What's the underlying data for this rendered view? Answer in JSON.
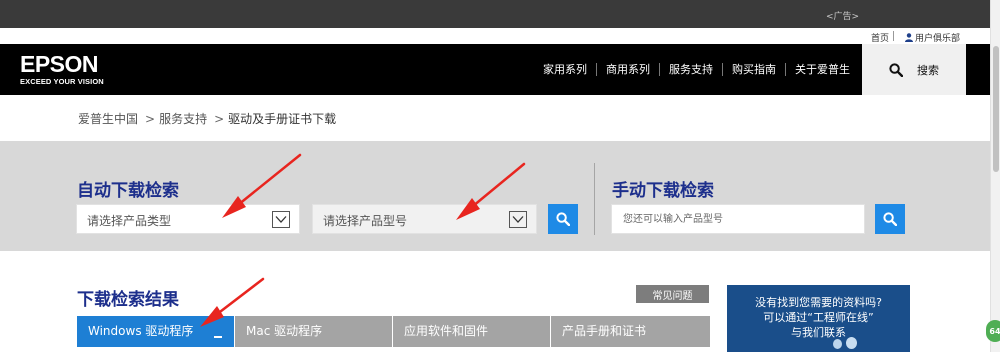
{
  "ad": {
    "label": "<广告>"
  },
  "utility": {
    "home": "首页",
    "club": "用户俱乐部"
  },
  "header": {
    "logo": "EPSON",
    "tagline": "EXCEED YOUR VISION",
    "nav": [
      "家用系列",
      "商用系列",
      "服务支持",
      "购买指南",
      "关于爱普生"
    ],
    "search_label": "搜索"
  },
  "breadcrumb": [
    "爱普生中国",
    "服务支持",
    "驱动及手册证书下载"
  ],
  "breadcrumb_sep": ">",
  "auto_search": {
    "title": "自动下载检索",
    "type_select": "请选择产品类型",
    "model_select": "请选择产品型号"
  },
  "manual_search": {
    "title": "手动下载检索",
    "placeholder": "您还可以输入产品型号"
  },
  "results": {
    "title": "下载检索结果",
    "faq": "常见问题",
    "tabs": [
      "Windows 驱动程序",
      "Mac 驱动程序",
      "应用软件和固件",
      "产品手册和证书"
    ],
    "active_tab": 0
  },
  "promo": {
    "line1": "没有找到您需要的资料吗?",
    "line2": "可以通过“工程师在线”",
    "line3": "与我们联系"
  },
  "side_badge": "64",
  "colors": {
    "brand_blue": "#1d2f8c",
    "accent_blue": "#1e8ae6",
    "annotation_red": "#e8251f"
  },
  "icons": {
    "search": "magnifier-icon",
    "dropdown": "chevron-down-icon",
    "user": "user-icon"
  }
}
